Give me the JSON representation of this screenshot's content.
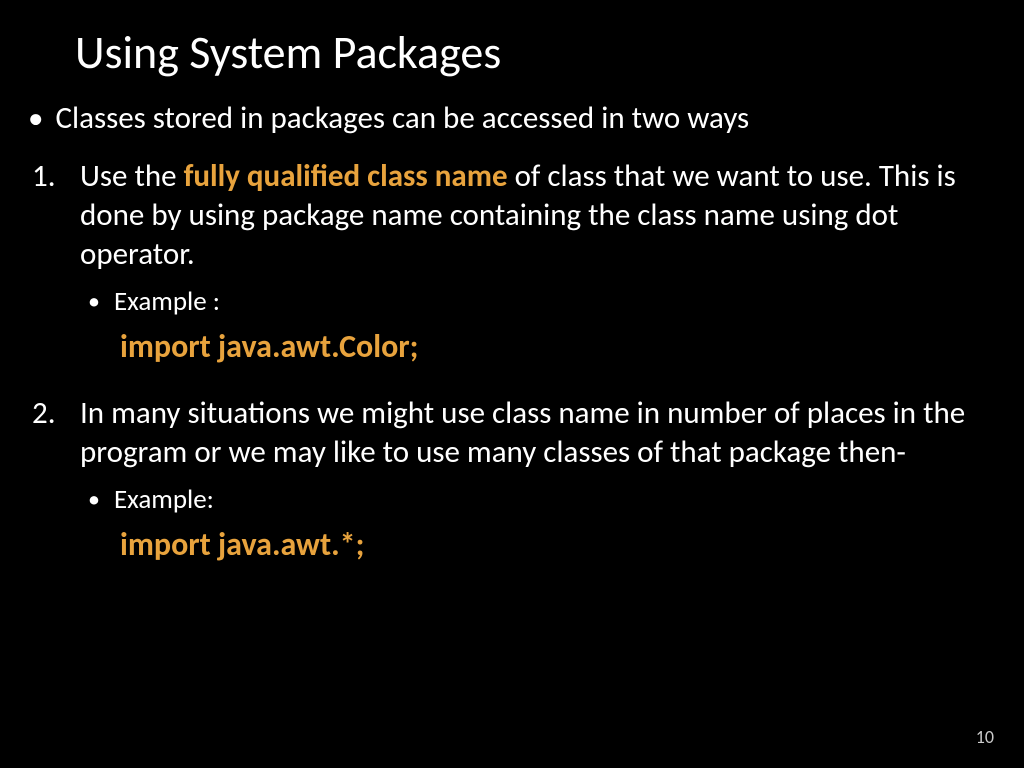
{
  "title": "Using System Packages",
  "intro": "Classes stored in packages can be accessed in two ways",
  "item1_num": "1.",
  "item1_pre": "Use the ",
  "item1_highlight": "fully qualified class name",
  "item1_post": " of class that we want to use. This is done by using package name containing the class name using dot operator.",
  "example1_label": "Example :",
  "example1_code": "import java.awt.Color;",
  "item2_num": "2.",
  "item2_text": "In many situations we might use class name in number of places in the program or we may like to use many classes of that package then-",
  "example2_label": "Example:",
  "example2_code": "import java.awt.*;",
  "page_number": "10"
}
